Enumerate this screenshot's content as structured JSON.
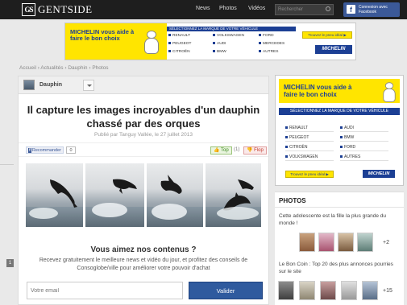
{
  "header": {
    "logo_mark": "GS",
    "logo_text": "GENTSIDE",
    "nav": [
      "News",
      "Photos",
      "Vidéos"
    ],
    "search_placeholder": "Rechercher",
    "facebook_label": "Connexion avec Facebook",
    "colors": {
      "bar": "#1e1e1e",
      "facebook": "#3b5998"
    }
  },
  "banner_ad": {
    "headline": "MICHELIN vous aide à faire le bon choix",
    "select_title": "SÉLECTIONNEZ LA MARQUE DE VOTRE VÉHICULE",
    "brands": [
      "RENAULT",
      "VOLKSWAGEN",
      "FORD",
      "PEUGEOT",
      "AUDI",
      "MERCEDES",
      "CITROËN",
      "BMW",
      "AUTRES"
    ],
    "cta": "Trouvez le pneu idéal ▶",
    "logo": "MICHELIN",
    "colors": {
      "yellow": "#ffe500",
      "blue": "#1c3f94"
    }
  },
  "breadcrumb": "Accueil › Actualités › Dauphin › Photos",
  "article": {
    "category": "Dauphin",
    "title": "Il capture les images incroyables d'un dauphin chassé par des orques",
    "byline": "Publié par Tanguy Vallée, le 27 juillet 2013",
    "share": {
      "facebook_label": "Recommander",
      "facebook_count": "0",
      "top_label": "Top",
      "top_count": "(1)",
      "flop_label": "Flop"
    },
    "photo_count": 4
  },
  "newsletter": {
    "title": "Vous aimez nos contenus ?",
    "text": "Recevez gratuitement le meilleure news et vidéo du jour, et profitez des conseils de Consoglobe/ville pour améliorer votre pouvoir d'achat",
    "email_placeholder": "Votre email",
    "submit_label": "Valider",
    "colors": {
      "button": "#2f5a9e"
    }
  },
  "sidebar_ad": {
    "headline": "MICHELIN vous aide à faire le bon choix",
    "select_title": "SÉLECTIONNEZ LA MARQUE DE VOTRE VÉHICULE",
    "brands": [
      "RENAULT",
      "AUDI",
      "PEUGEOT",
      "BMW",
      "CITROËN",
      "FORD",
      "VOLKSWAGEN",
      "AUTRES"
    ],
    "cta": "Trouvez le pneu idéal ▶",
    "logo": "MICHELIN"
  },
  "photos_panel": {
    "heading": "PHOTOS",
    "galleries": [
      {
        "title": "Cette adolescente est la fille la plus grande du monde !",
        "more": "+2"
      },
      {
        "title": "Le Bon Coin : Top 20 des plus annonces pourries sur le site",
        "more": "+15"
      }
    ]
  },
  "side_tab": "1"
}
